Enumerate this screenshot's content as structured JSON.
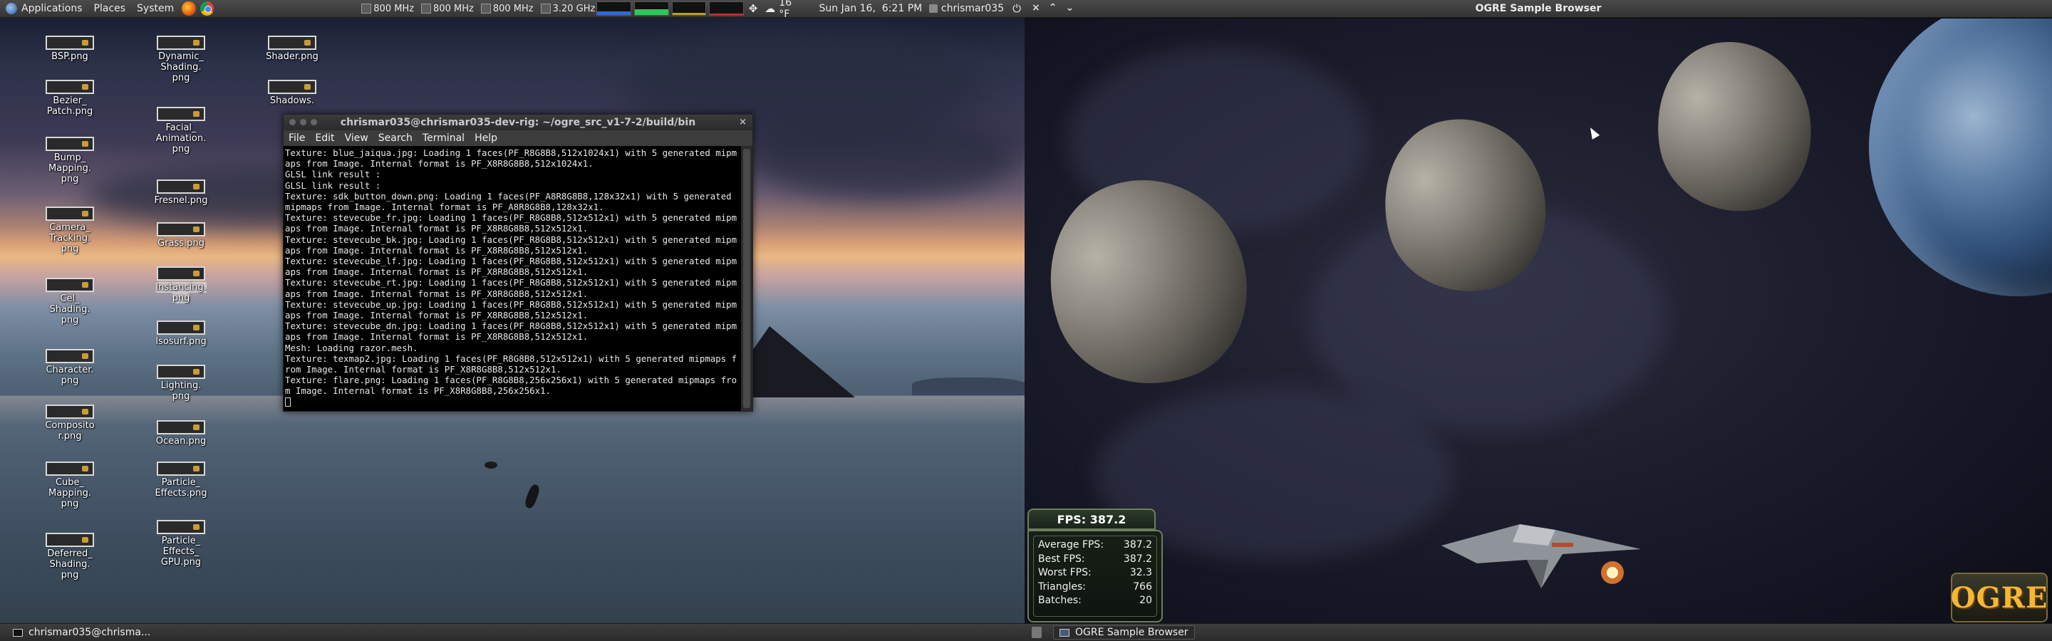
{
  "top_panel": {
    "menus": [
      "Applications",
      "Places",
      "System"
    ],
    "cpu_freqs": [
      "800 MHz",
      "800 MHz",
      "800 MHz",
      "3.20 GHz"
    ],
    "temperature": "16 °F",
    "datetime": "Sun Jan 16,  6:21 PM",
    "user": "chrismar035"
  },
  "desktop_icons": [
    {
      "label": "BSP.png"
    },
    {
      "label": "Bezier_ Patch.png"
    },
    {
      "label": "Bump_ Mapping. png"
    },
    {
      "label": "Camera_ Tracking. png"
    },
    {
      "label": "Cel_ Shading. png"
    },
    {
      "label": "Character. png"
    },
    {
      "label": "Composito r.png"
    },
    {
      "label": "Cube_ Mapping. png"
    },
    {
      "label": "Deferred_ Shading. png"
    },
    {
      "label": "Dynamic_ Shading. png"
    },
    {
      "label": "Facial_ Animation. png"
    },
    {
      "label": "Fresnel.png"
    },
    {
      "label": "Grass.png"
    },
    {
      "label": "Instancing. png"
    },
    {
      "label": "Isosurf.png"
    },
    {
      "label": "Lighting. png"
    },
    {
      "label": "Ocean.png"
    },
    {
      "label": "Particle_ Effects.png"
    },
    {
      "label": "Particle_ Effects_ GPU.png"
    },
    {
      "label": "Shader.png"
    },
    {
      "label": "Shadows."
    }
  ],
  "terminal": {
    "title": "chrismar035@chrismar035-dev-rig: ~/ogre_src_v1-7-2/build/bin",
    "menu": [
      "File",
      "Edit",
      "View",
      "Search",
      "Terminal",
      "Help"
    ],
    "output": "Texture: blue_jaiqua.jpg: Loading 1 faces(PF_R8G8B8,512x1024x1) with 5 generated mipmaps from Image. Internal format is PF_X8R8G8B8,512x1024x1.\nGLSL link result :\nGLSL link result :\nTexture: sdk_button_down.png: Loading 1 faces(PF_A8R8G8B8,128x32x1) with 5 generated mipmaps from Image. Internal format is PF_A8R8G8B8,128x32x1.\nTexture: stevecube_fr.jpg: Loading 1 faces(PF_R8G8B8,512x512x1) with 5 generated mipmaps from Image. Internal format is PF_X8R8G8B8,512x512x1.\nTexture: stevecube_bk.jpg: Loading 1 faces(PF_R8G8B8,512x512x1) with 5 generated mipmaps from Image. Internal format is PF_X8R8G8B8,512x512x1.\nTexture: stevecube_lf.jpg: Loading 1 faces(PF_R8G8B8,512x512x1) with 5 generated mipmaps from Image. Internal format is PF_X8R8G8B8,512x512x1.\nTexture: stevecube_rt.jpg: Loading 1 faces(PF_R8G8B8,512x512x1) with 5 generated mipmaps from Image. Internal format is PF_X8R8G8B8,512x512x1.\nTexture: stevecube_up.jpg: Loading 1 faces(PF_R8G8B8,512x512x1) with 5 generated mipmaps from Image. Internal format is PF_X8R8G8B8,512x512x1.\nTexture: stevecube_dn.jpg: Loading 1 faces(PF_R8G8B8,512x512x1) with 5 generated mipmaps from Image. Internal format is PF_X8R8G8B8,512x512x1.\nMesh: Loading razor.mesh.\nTexture: texmap2.jpg: Loading 1 faces(PF_R8G8B8,512x512x1) with 5 generated mipmaps from Image. Internal format is PF_X8R8G8B8,512x512x1.\nTexture: flare.png: Loading 1 faces(PF_R8G8B8,256x256x1) with 5 generated mipmaps from Image. Internal format is PF_X8R8G8B8,256x256x1."
  },
  "taskbar_left": {
    "item": "chrismar035@chrisma..."
  },
  "ogre_window": {
    "title": "OGRE Sample Browser"
  },
  "stats": {
    "fps": "FPS: 387.2",
    "rows": [
      {
        "label": "Average FPS:",
        "value": "387.2"
      },
      {
        "label": "Best FPS:",
        "value": "387.2"
      },
      {
        "label": "Worst FPS:",
        "value": "32.3"
      },
      {
        "label": "Triangles:",
        "value": "766"
      },
      {
        "label": "Batches:",
        "value": "20"
      }
    ]
  },
  "ogre_logo": "OGRE",
  "taskbar_right": {
    "item": "OGRE Sample Browser"
  },
  "colors": {
    "accent_logo": "#f5b833",
    "terminal_bg": "#000000",
    "panel": "#3a3a3a"
  },
  "icons": [
    "firefox-icon",
    "chrome-icon",
    "cpu-icon",
    "weather-icon",
    "power-icon",
    "terminal-icon",
    "trash-icon"
  ]
}
